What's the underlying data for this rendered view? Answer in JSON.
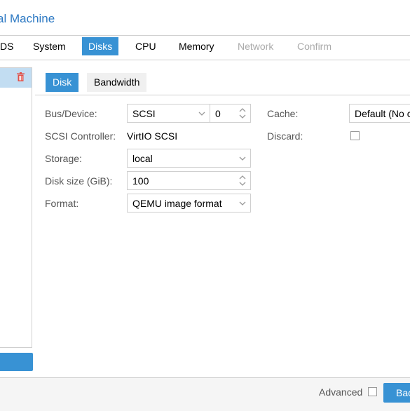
{
  "window": {
    "title": "al Machine"
  },
  "wizard_tabs": [
    {
      "label": "DS",
      "state": "normal"
    },
    {
      "label": "System",
      "state": "normal"
    },
    {
      "label": "Disks",
      "state": "active"
    },
    {
      "label": "CPU",
      "state": "normal"
    },
    {
      "label": "Memory",
      "state": "normal"
    },
    {
      "label": "Network",
      "state": "disabled"
    },
    {
      "label": "Confirm",
      "state": "disabled"
    }
  ],
  "disk_list": {
    "delete_icon": "trash-icon"
  },
  "sub_tabs": [
    {
      "label": "Disk",
      "state": "active"
    },
    {
      "label": "Bandwidth",
      "state": "inactive"
    }
  ],
  "form": {
    "bus_device": {
      "label": "Bus/Device:",
      "bus": "SCSI",
      "device": "0"
    },
    "scsi_controller": {
      "label": "SCSI Controller:",
      "value": "VirtIO SCSI"
    },
    "storage": {
      "label": "Storage:",
      "value": "local"
    },
    "disk_size": {
      "label": "Disk size (GiB):",
      "value": "100"
    },
    "format": {
      "label": "Format:",
      "value": "QEMU image format"
    },
    "cache": {
      "label": "Cache:",
      "value": "Default (No c"
    },
    "discard": {
      "label": "Discard:",
      "checked": false
    }
  },
  "footer": {
    "advanced_label": "Advanced",
    "advanced_checked": false,
    "next_label": "Bac"
  },
  "colors": {
    "accent": "#3892d4",
    "title": "#2d79c3",
    "delete": "#e0524a"
  }
}
